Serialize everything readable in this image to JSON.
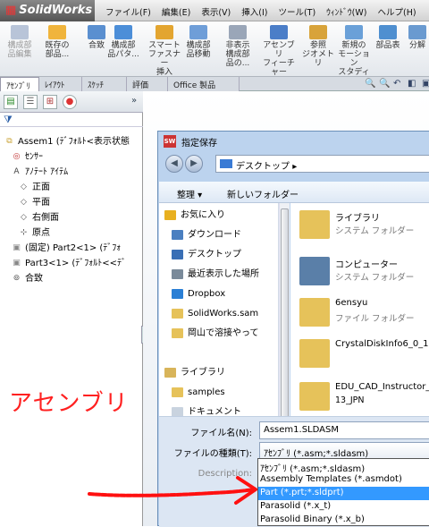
{
  "app": {
    "title": "SolidWorks"
  },
  "menu": [
    "ファイル(F)",
    "編集(E)",
    "表示(V)",
    "挿入(I)",
    "ツール(T)",
    "ｳｨﾝﾄﾞｳ(W)",
    "ヘルプ(H)"
  ],
  "ribbon": [
    {
      "label": "構成部\n品編集",
      "dim": true
    },
    {
      "label": "既存の\n部品...",
      "dim": false
    },
    {
      "label": "合致",
      "dim": false
    },
    {
      "label": "構成部\n品パタ...",
      "dim": false
    },
    {
      "label": "スマート\nファスナー\n挿入",
      "dim": false
    },
    {
      "label": "構成部\n品移動",
      "dim": false
    },
    {
      "label": "非表示\n構成部\n品の...",
      "dim": false
    },
    {
      "label": "アセンブリ\nフィーチャー",
      "dim": false
    },
    {
      "label": "参照\nジオメトリ",
      "dim": false
    },
    {
      "label": "新規の\nモーション\nスタディ",
      "dim": false
    },
    {
      "label": "部品表",
      "dim": false
    },
    {
      "label": "分解",
      "dim": false
    }
  ],
  "tabs": [
    "ｱｾﾝﾌﾞﾘ",
    "ﾚｲｱｳﾄ",
    "ｽｹｯﾁ",
    "評価",
    "Office 製品"
  ],
  "tree": [
    {
      "label": "Assem1 (ﾃﾞﾌｫﾙﾄ<表示状態",
      "indent": 0,
      "icon": "assembly-icon"
    },
    {
      "label": "ｾﾝｻｰ",
      "indent": 1,
      "icon": "sensor-icon"
    },
    {
      "label": "ｱﾉﾃｰﾄ ｱｲﾃﾑ",
      "indent": 1,
      "icon": "annotation-icon"
    },
    {
      "label": "正面",
      "indent": 2,
      "icon": "plane-icon"
    },
    {
      "label": "平面",
      "indent": 2,
      "icon": "plane-icon"
    },
    {
      "label": "右側面",
      "indent": 2,
      "icon": "plane-icon"
    },
    {
      "label": "原点",
      "indent": 2,
      "icon": "origin-icon"
    },
    {
      "label": "(固定) Part2<1> (ﾃﾞﾌｫ",
      "indent": 1,
      "icon": "part-icon"
    },
    {
      "label": "Part3<1> (ﾃﾞﾌｫﾙﾄ<<ﾃﾞ",
      "indent": 1,
      "icon": "part-icon"
    },
    {
      "label": "合致",
      "indent": 1,
      "icon": "mate-icon"
    }
  ],
  "annotation_text": "アセンブリ",
  "dialog": {
    "title": "指定保存",
    "address": "デスクトップ",
    "organize": "整理 ▾",
    "new_folder": "新しいフォルダー",
    "nav": [
      {
        "label": "お気に入り",
        "icon": "star-icon",
        "color": "#e8b020",
        "indent": 0
      },
      {
        "label": "ダウンロード",
        "icon": "download-icon",
        "color": "#4a7fc0",
        "indent": 1
      },
      {
        "label": "デスクトップ",
        "icon": "desktop-icon",
        "color": "#3a6fb5",
        "indent": 1
      },
      {
        "label": "最近表示した場所",
        "icon": "recent-icon",
        "color": "#7a8a9a",
        "indent": 1
      },
      {
        "label": "Dropbox",
        "icon": "dropbox-icon",
        "color": "#2a7fd5",
        "indent": 1
      },
      {
        "label": "SolidWorks.sam",
        "icon": "folder-icon",
        "color": "#e6c25a",
        "indent": 1
      },
      {
        "label": "岡山で溶接やって",
        "icon": "folder-icon",
        "color": "#e6c25a",
        "indent": 1
      },
      {
        "label": "",
        "icon": "",
        "color": "",
        "indent": 0
      },
      {
        "label": "ライブラリ",
        "icon": "library-icon",
        "color": "#d8b45a",
        "indent": 0
      },
      {
        "label": "samples",
        "icon": "folder-icon",
        "color": "#e6c25a",
        "indent": 1
      },
      {
        "label": "ドキュメント",
        "icon": "documents-icon",
        "color": "#c9d3df",
        "indent": 1
      }
    ],
    "files": [
      {
        "name": "ライブラリ",
        "type": "システム フォルダー",
        "color": "#e6c25a"
      },
      {
        "name": "コンピューター",
        "type": "システム フォルダー",
        "color": "#5a7fa8"
      },
      {
        "name": "6ensyu",
        "type": "ファイル フォルダー",
        "color": "#e6c25a"
      },
      {
        "name": "CrystalDiskInfo6_0_1",
        "type": "",
        "color": "#e6c25a"
      },
      {
        "name": "EDU_CAD_Instructor_",
        "type": "13_JPN",
        "color": "#e6c25a"
      }
    ],
    "filename_label": "ファイル名(N):",
    "filename_value": "Assem1.SLDASM",
    "filetype_label": "ファイルの種類(T):",
    "filetype_value": "ｱｾﾝﾌﾞﾘ (*.asm;*.sldasm)",
    "description_label": "Description:",
    "dropdown_options": [
      "ｱｾﾝﾌﾞﾘ (*.asm;*.sldasm)",
      "Assembly Templates (*.asmdot)",
      "Part (*.prt;*.sldprt)",
      "Parasolid (*.x_t)",
      "Parasolid Binary (*.x_b)"
    ],
    "dropdown_selected_index": 2
  }
}
